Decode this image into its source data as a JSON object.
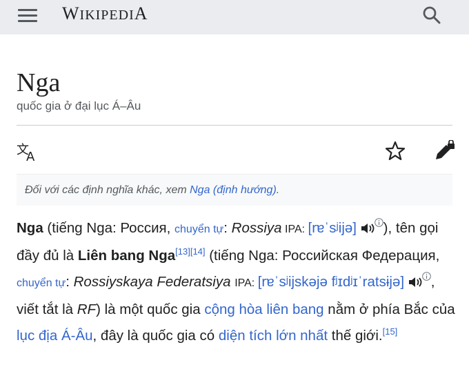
{
  "header": {
    "logo_big_w": "W",
    "logo_small_iki": "IKIPEDI",
    "logo_big_a": "A"
  },
  "page": {
    "title": "Nga",
    "subtitle": "quốc gia ở đại lục Á–Âu"
  },
  "hatnote": {
    "prefix": "Đối với các định nghĩa khác, xem ",
    "link": "Nga (định hướng)",
    "suffix": "."
  },
  "article": {
    "t1": "Nga",
    "t2": " (tiếng Nga: Россия, ",
    "link_translit": "chuyển tự",
    "t3": ": ",
    "t4": "Rossiya",
    "ipa1": " IPA: ",
    "ipa1_link": "[rɐˈsʲijə]",
    "t5": "), tên gọi đầy đủ là ",
    "t6": "Liên bang Nga",
    "ref13": "[13]",
    "ref14": "[14]",
    "t7": " (tiếng Nga: Российская Федерация, ",
    "link_translit2": "chuyển tự",
    "t8": ": ",
    "t9": "Rossiyskaya Federatsiya",
    "ipa2": "IPA: ",
    "ipa2_link": "[rɐˈsʲijskəjə fʲɪdʲɪˈratsɨjə]",
    "t10": ", viết tắt là ",
    "t11": "RF",
    "t12": ") là một quốc gia ",
    "link_federal": "cộng hòa liên bang",
    "t13": " nằm ở phía Bắc của ",
    "link_eurasia": "lục địa Á-Âu",
    "t14": ", đây là quốc gia có ",
    "link_largest": "diện tích lớn nhất",
    "t15": " thế giới.",
    "ref15": "[15]"
  },
  "colors": {
    "link": "#3366cc",
    "text": "#202122",
    "muted": "#54595d"
  },
  "icons": [
    "menu-icon",
    "search-icon",
    "language-icon",
    "star-icon",
    "edit-lock-icon",
    "speaker-icon",
    "info-icon"
  ]
}
